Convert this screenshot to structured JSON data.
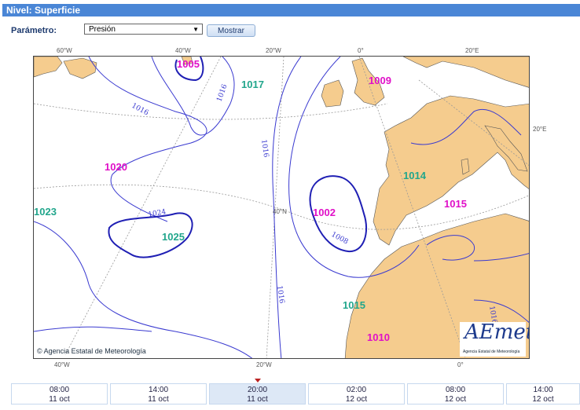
{
  "header": {
    "title": "Nivel: Superficie"
  },
  "controls": {
    "param_label": "Parámetro:",
    "param_value": "Presión",
    "submit_label": "Mostrar"
  },
  "map": {
    "lon_labels_top": [
      "60°W",
      "40°W",
      "20°W",
      "0°",
      "20°E"
    ],
    "lon_labels_bottom": [
      "40°W",
      "20°W",
      "0°"
    ],
    "lat_labels": [
      "40°N",
      "20°E"
    ],
    "isobar_labels": [
      "1016",
      "1016",
      "1016",
      "1024",
      "1008",
      "1016",
      "1016"
    ],
    "pressure_labels": [
      {
        "text": "1005",
        "kind": "low"
      },
      {
        "text": "1017",
        "kind": "high"
      },
      {
        "text": "1009",
        "kind": "low"
      },
      {
        "text": "1020",
        "kind": "low"
      },
      {
        "text": "1014",
        "kind": "high"
      },
      {
        "text": "1023",
        "kind": "high"
      },
      {
        "text": "1002",
        "kind": "low"
      },
      {
        "text": "1015",
        "kind": "low"
      },
      {
        "text": "1025",
        "kind": "high"
      },
      {
        "text": "1015",
        "kind": "high"
      },
      {
        "text": "1010",
        "kind": "low"
      }
    ],
    "colors": {
      "low": "#e010c8",
      "high": "#22a68c",
      "land": "#f5cc8e",
      "isobar": "#3a3ad0",
      "grid": "#999999"
    },
    "credit": "Agencia Estatal de Meteorología",
    "logo_text": "AEmet",
    "logo_sub": "Agencia Estatal de Meteorología"
  },
  "timeline": [
    {
      "time": "08:00",
      "date": "11 oct",
      "selected": false
    },
    {
      "time": "14:00",
      "date": "11 oct",
      "selected": false
    },
    {
      "time": "20:00",
      "date": "11 oct",
      "selected": true
    },
    {
      "time": "02:00",
      "date": "12 oct",
      "selected": false
    },
    {
      "time": "08:00",
      "date": "12 oct",
      "selected": false
    },
    {
      "time": "14:00",
      "date": "12 oct",
      "selected": false
    }
  ]
}
